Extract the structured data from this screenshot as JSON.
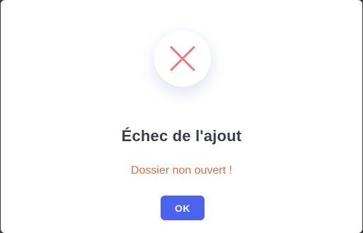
{
  "dialog": {
    "icon": "close-x-icon",
    "title": "Échec de l'ajout",
    "message": "Dossier non ouvert !",
    "ok_label": "OK"
  },
  "colors": {
    "icon": "#ea7b7b",
    "title": "#3b3d55",
    "message": "#e0703f",
    "button": "#4b63ee"
  }
}
